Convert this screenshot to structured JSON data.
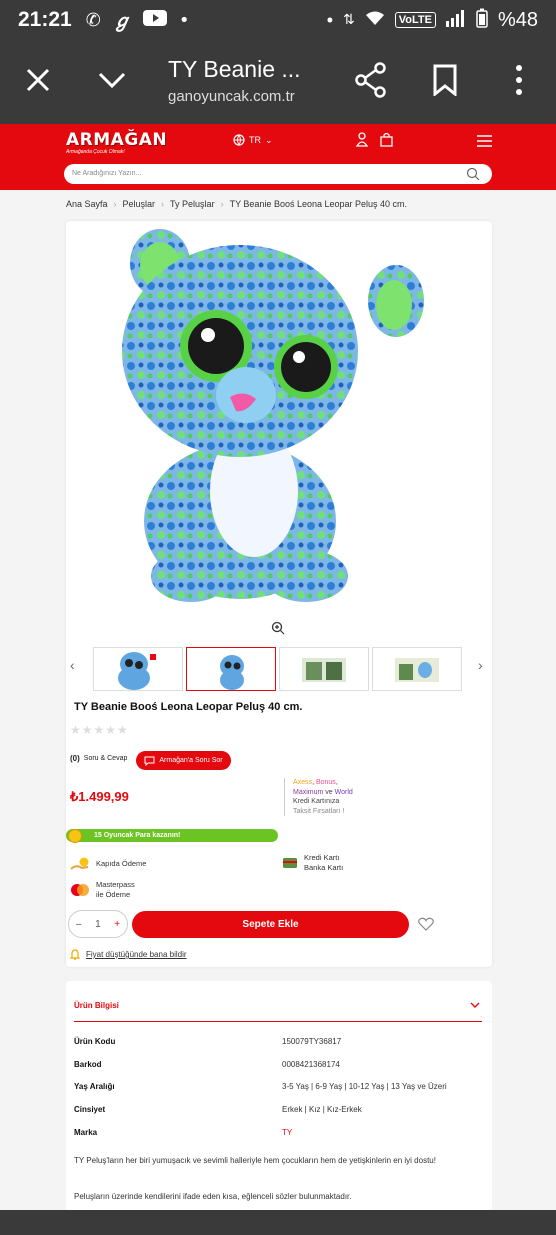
{
  "status": {
    "time": "21:21",
    "volte": "VoLTE",
    "battery": "%48"
  },
  "chrome": {
    "title": "TY Beanie ...",
    "url": "ganoyuncak.com.tr"
  },
  "header": {
    "logo": "ARMAĞAN",
    "logo_sub": "Armağanda Çocuk Olmak!",
    "lang": "TR",
    "search_placeholder": "Ne Aradığınızı Yazın..."
  },
  "breadcrumb": [
    "Ana Sayfa",
    "Peluşlar",
    "Ty Peluşlar",
    "TY Beanie Booś Leona Leopar Peluş 40 cm."
  ],
  "product": {
    "title": "TY Beanie Booś Leona Leopar Peluş 40 cm.",
    "rating_stars": 0,
    "qa_count": "(0)",
    "qa_label": "Soru & Cevap",
    "ask_button": "Armağan'a Soru Sor",
    "price": "₺1.499,99",
    "installment": {
      "axess": "Axess",
      "bonus": "Bonus",
      "maximum": "Maximum",
      "ve": "ve",
      "world": "World",
      "line2": "Kredi Kartınıza",
      "line3": "Taksit Fırsatları !"
    },
    "promo": "15 Oyuncak Para kazanın!",
    "payments": {
      "door": "Kapıda Ödeme",
      "credit1": "Kredi Kartı",
      "credit2": "Banka Kartı",
      "mp1": "Masterpass",
      "mp2": "ile Ödeme"
    },
    "qty": {
      "minus": "–",
      "value": "1",
      "plus": "+"
    },
    "add_to_cart": "Sepete Ekle",
    "notify": "Fiyat düştüğünde bana bildir"
  },
  "info": {
    "heading": "Ürün Bilgisi",
    "rows": [
      {
        "k": "Ürün Kodu",
        "v": "150079TY36817"
      },
      {
        "k": "Barkod",
        "v": "0008421368174"
      },
      {
        "k": "Yaş Aralığı",
        "v": "3-5 Yaş | 6-9 Yaş | 10-12 Yaş | 13 Yaş ve Üzeri"
      },
      {
        "k": "Cinsiyet",
        "v": "Erkek | Kız | Kız-Erkek"
      },
      {
        "k": "Marka",
        "v": "TY"
      }
    ],
    "desc1": "TY Peluş'ların her biri yumuşacık ve sevimli halleriyle hem çocukların hem de yetişkinlerin en iyi dostu!",
    "desc2": "Peluşların üzerinde kendilerini ifade eden kısa, eğlenceli sözler bulunmaktadır."
  },
  "colors": {
    "brand": "#e3090f",
    "promo": "#6cc424",
    "chrome": "#3a3a3a"
  }
}
